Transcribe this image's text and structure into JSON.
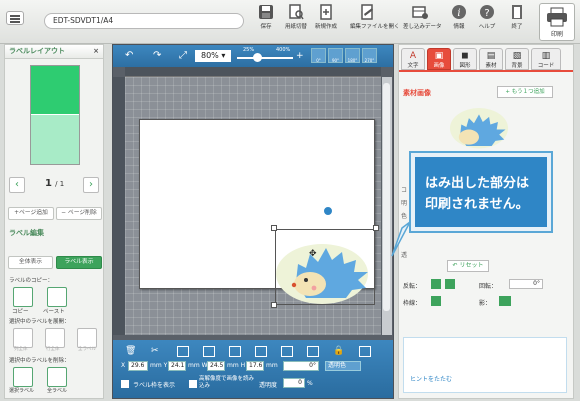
{
  "topbar": {
    "filename": "EDT-SDVDT1/A4",
    "buttons": [
      "保存",
      "用紙切替",
      "新規作成",
      "編集ファイルを開く",
      "差し込みデータ",
      "情報",
      "ヘルプ",
      "終了"
    ],
    "print": "印刷"
  },
  "left": {
    "layout_title": "ラベルレイアウト",
    "close": "×",
    "page_current": "1",
    "page_total": "/ 1",
    "add_page": "+ページ追加",
    "del_page": "− ページ削除",
    "edit_title": "ラベル編集",
    "all_view": "全体表示",
    "label_view": "ラベル表示",
    "copy_title": "ラベルのコピー：",
    "copy": "コピー",
    "paste": "ペースト",
    "expand_title": "選択中のラベルを展開：",
    "expand_items": [
      "列全体",
      "行全体",
      "全ラベル"
    ],
    "delete_title": "選択中のラベルを削除：",
    "delete_items": [
      "選択ラベル",
      "全ラベル"
    ]
  },
  "canvas": {
    "zoom": "80%",
    "slider_min": "25%",
    "slider_max": "400%",
    "rotate": [
      "0°",
      "90°",
      "180°",
      "270°"
    ],
    "x_label": "X",
    "x": "29.6",
    "y_label": "mm Y",
    "y": "24.1",
    "w_label": "mm W",
    "w": "24.5",
    "h_label": "mm H",
    "h": "17.6",
    "mm": "mm",
    "angle": "0°",
    "transparent": "透明色",
    "show_frame": "ラベル枠を表示",
    "hires": "高解像度で画像を読み込み",
    "opacity_label": "透明度",
    "opacity": "0",
    "pct": "%"
  },
  "right": {
    "tabs": [
      "文字",
      "画像",
      "図形",
      "素材",
      "背景",
      "コード"
    ],
    "section": "素材画像",
    "add_one": "+ もう１つ追加",
    "reset": "リセット",
    "flip": "反転：",
    "rotate": "回転：",
    "rotate_val": "0°",
    "border": "枠線：",
    "shadow": "影：",
    "hide_hint": "ヒントをたたむ",
    "partial_labels": [
      "コ",
      "明",
      "色",
      "透"
    ]
  },
  "tooltip": {
    "text1": "はみ出した部分は",
    "text2": "印刷されません。"
  },
  "colors": {
    "accent_green": "#3da35c",
    "blue": "#2f86c6",
    "active_tab": "#e74c3c"
  }
}
